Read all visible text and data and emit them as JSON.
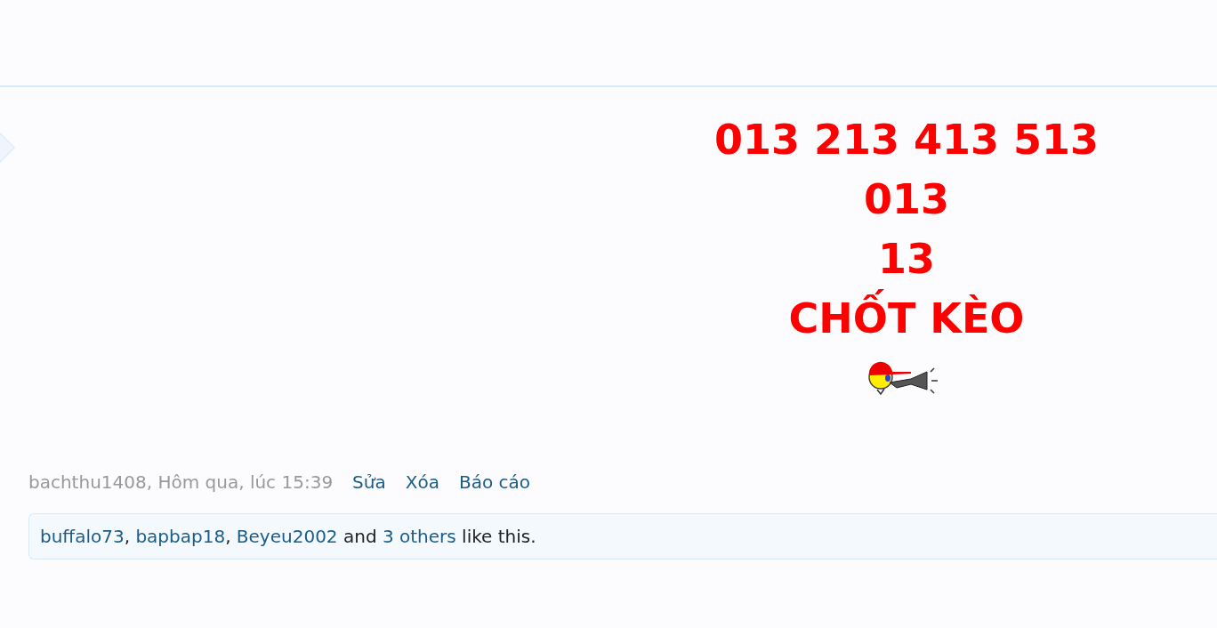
{
  "message": {
    "lines": [
      "013 213 413 513",
      "013",
      "13",
      "CHỐT KÈO"
    ]
  },
  "meta": {
    "info": "bachthu1408, Hôm qua, lúc 15:39",
    "actions": [
      "Sửa",
      "Xóa",
      "Báo cáo"
    ]
  },
  "likes": {
    "parts": [
      {
        "kind": "link",
        "text": "buffalo73"
      },
      {
        "kind": "text",
        "text": ", "
      },
      {
        "kind": "link",
        "text": "bapbap18"
      },
      {
        "kind": "text",
        "text": ", "
      },
      {
        "kind": "link",
        "text": "Beyeu2002"
      },
      {
        "kind": "text",
        "text": " and "
      },
      {
        "kind": "link",
        "text": "3 others"
      },
      {
        "kind": "text",
        "text": " like this."
      }
    ]
  }
}
